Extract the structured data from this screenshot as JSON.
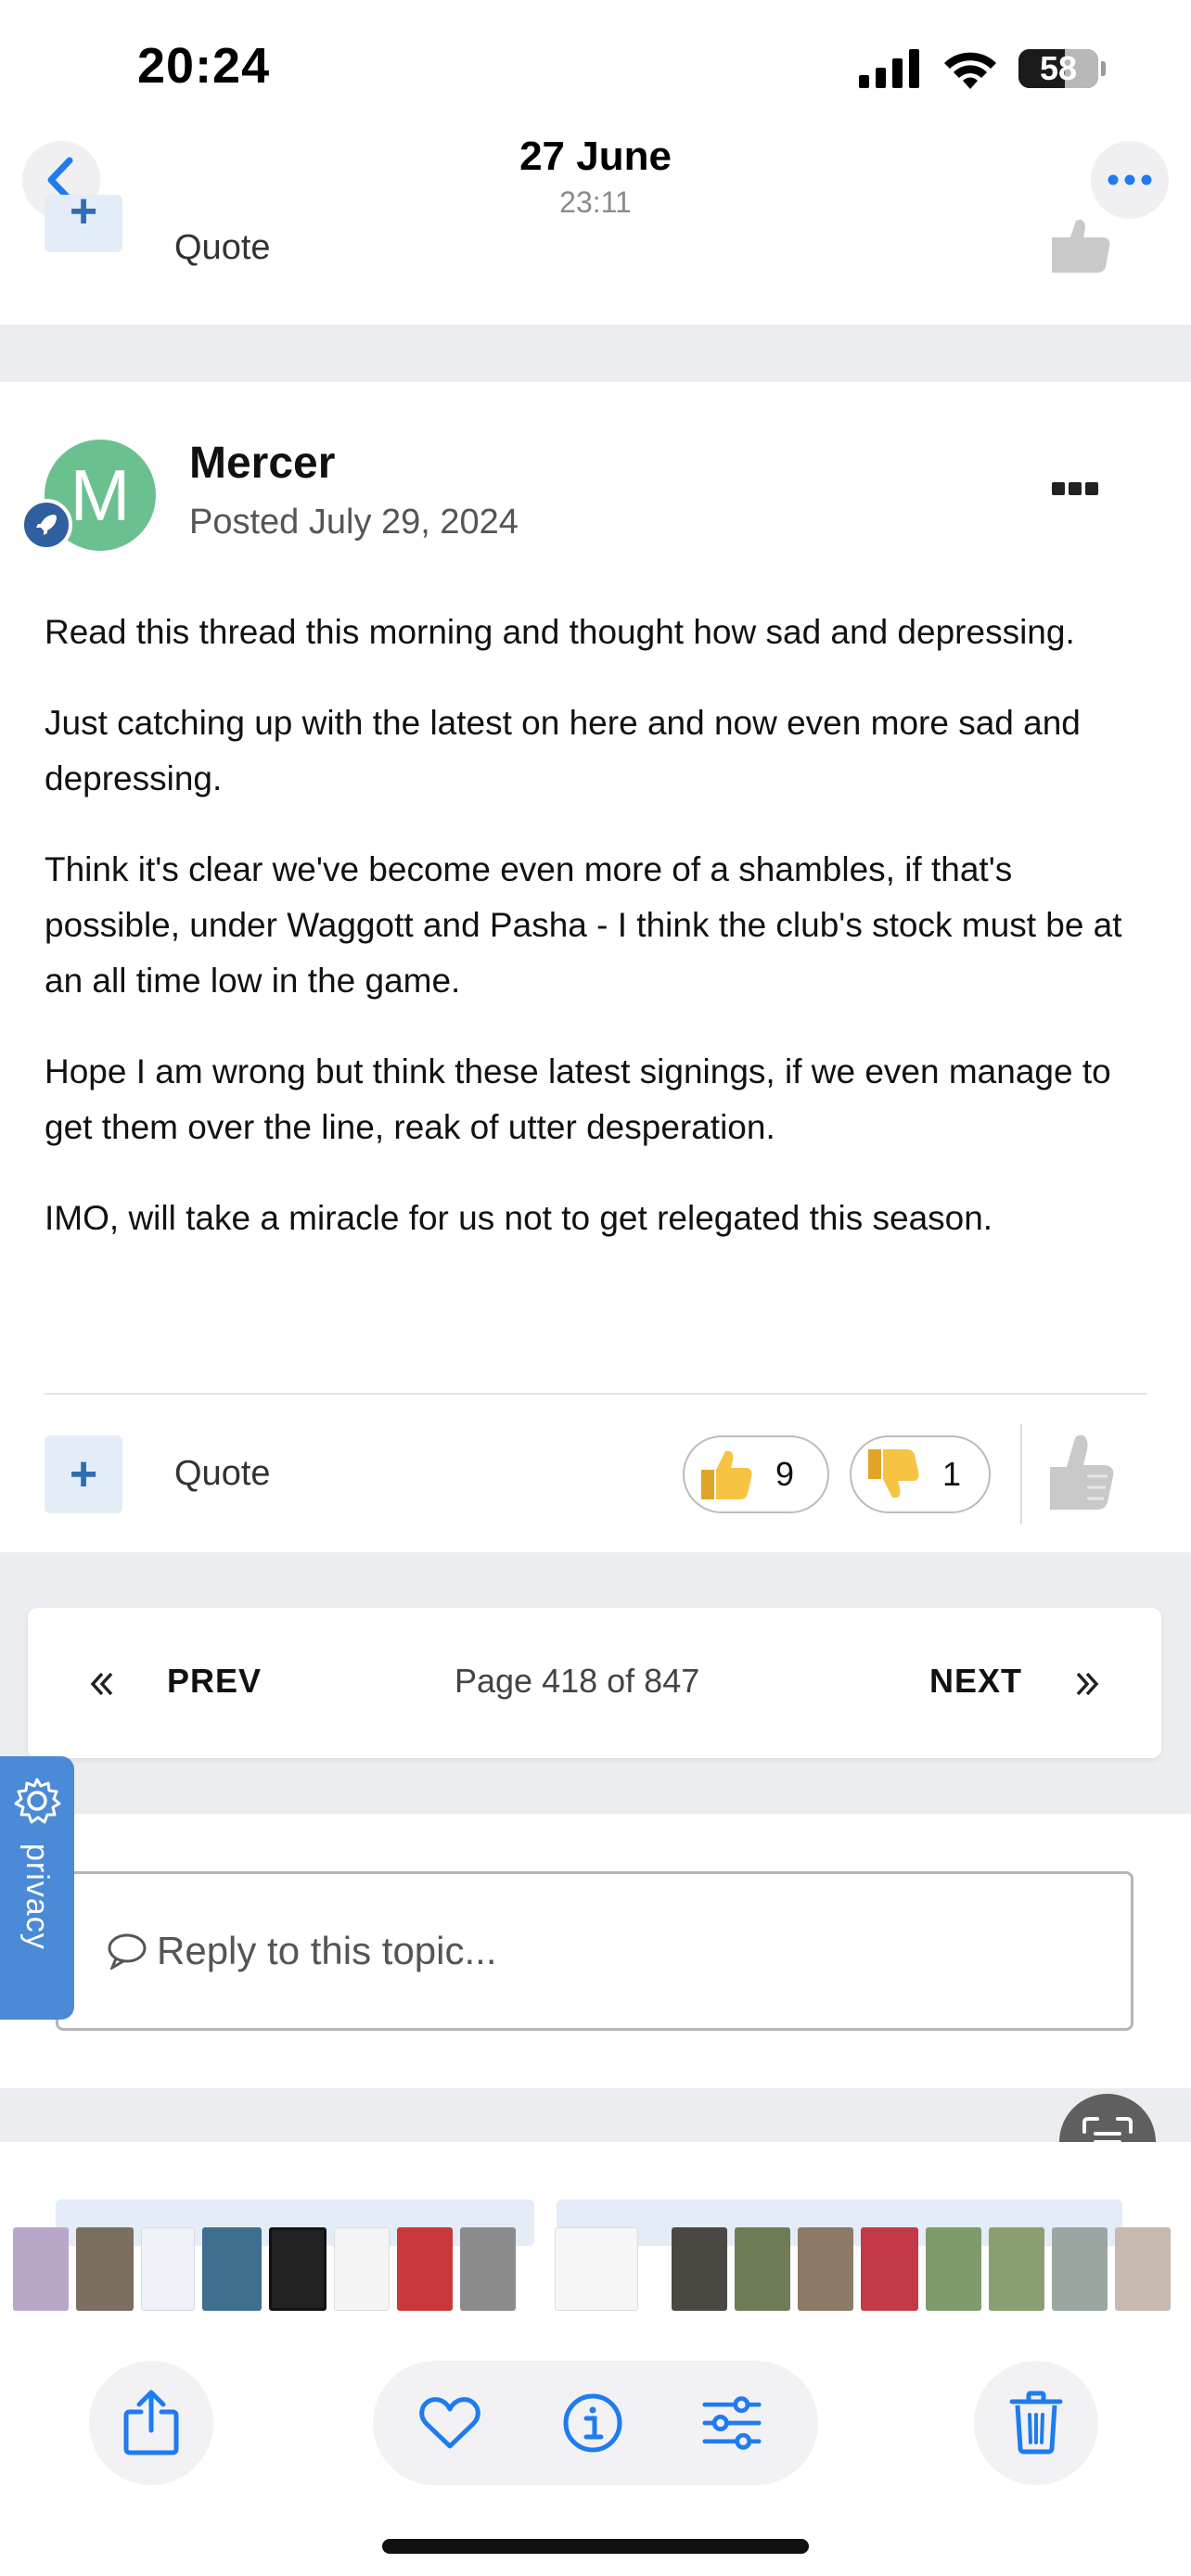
{
  "status_bar": {
    "time": "20:24",
    "battery": "58"
  },
  "nav": {
    "title": "27 June",
    "subtitle": "23:11"
  },
  "prev_post": {
    "quote_label": "Quote"
  },
  "post": {
    "avatar_letter": "M",
    "author": "Mercer",
    "date": "Posted July 29, 2024",
    "paragraphs": [
      "Read this thread this morning and thought how sad and depressing.",
      "Just catching up with the latest on here and now even more sad and depressing.",
      "Think it's clear we've become even more of a shambles, if that's possible, under Waggott and Pasha - I think the club's stock must be at an all time low in the game.",
      "Hope I am wrong but think these latest signings, if we even manage to get them over the line, reak of utter desperation.",
      "IMO, will take a miracle for us not to get relegated this season."
    ],
    "quote_label": "Quote",
    "reactions": {
      "thumbs_up": "9",
      "thumbs_down": "1"
    }
  },
  "pagination": {
    "prev": "PREV",
    "next": "NEXT",
    "page_info": "Page 418 of 847"
  },
  "reply": {
    "placeholder": "Reply to this topic..."
  },
  "privacy": {
    "label": "privacy"
  },
  "colors": {
    "accent": "#2f6db5",
    "avatar_bg": "#6ac18f",
    "ios_blue": "#1f7bf0",
    "privacy_tab": "#4a8ad6"
  }
}
